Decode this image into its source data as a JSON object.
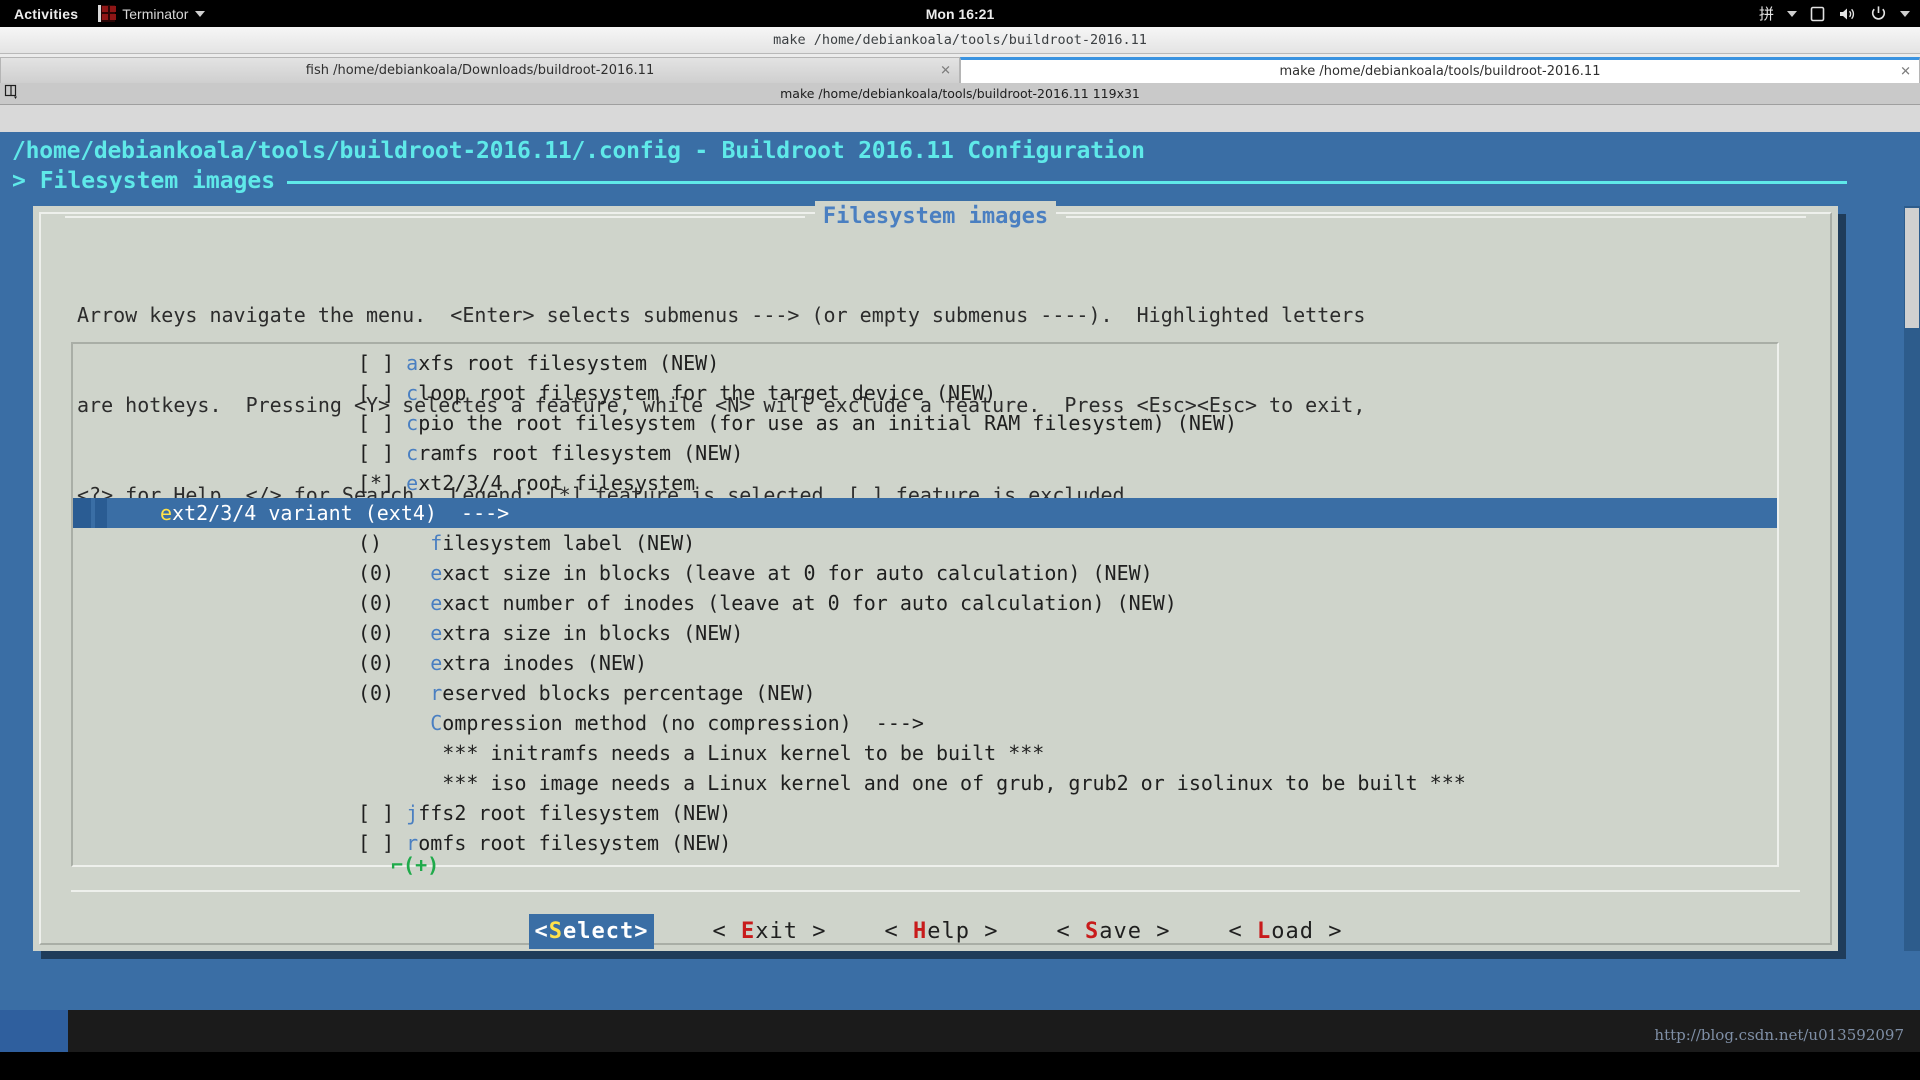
{
  "topbar": {
    "activities": "Activities",
    "app_name": "Terminator",
    "clock": "Mon 16:21",
    "ime": "拼"
  },
  "window": {
    "title": "make  /home/debiankoala/tools/buildroot-2016.11",
    "tabs": [
      {
        "label": "fish  /home/debiankoala/Downloads/buildroot-2016.11",
        "close": "✕",
        "active": false
      },
      {
        "label": "make  /home/debiankoala/tools/buildroot-2016.11",
        "close": "✕",
        "active": true
      }
    ],
    "terminal_title": "make  /home/debiankoala/tools/buildroot-2016.11 119x31"
  },
  "menuconfig": {
    "header_title": "/home/debiankoala/tools/buildroot-2016.11/.config - Buildroot 2016.11 Configuration",
    "breadcrumb": "> Filesystem images",
    "dialog_title": "Filesystem images",
    "help_lines": [
      "Arrow keys navigate the menu.  <Enter> selects submenus ---> (or empty submenus ----).  Highlighted letters",
      "are hotkeys.  Pressing <Y> selectes a feature, while <N> will exclude a feature.  Press <Esc><Esc> to exit,",
      "<?> for Help, </> for Search.  Legend: [*] feature is selected  [ ] feature is excluded"
    ],
    "scroll_hint": "⌐(+)",
    "items": [
      {
        "prefix": "[ ] ",
        "indent": "",
        "hotkey": "a",
        "text": "xfs root filesystem (NEW)",
        "suffix": "",
        "selected": false,
        "type": "checkbox"
      },
      {
        "prefix": "[ ] ",
        "indent": "",
        "hotkey": "c",
        "text": "loop root filesystem for the target device (NEW)",
        "suffix": "",
        "selected": false,
        "type": "checkbox"
      },
      {
        "prefix": "[ ] ",
        "indent": "",
        "hotkey": "c",
        "text": "pio the root filesystem (for use as an initial RAM filesystem) (NEW)",
        "suffix": "",
        "selected": false,
        "type": "checkbox"
      },
      {
        "prefix": "[ ] ",
        "indent": "",
        "hotkey": "c",
        "text": "ramfs root filesystem (NEW)",
        "suffix": "",
        "selected": false,
        "type": "checkbox"
      },
      {
        "prefix": "[*] ",
        "indent": "",
        "hotkey": "e",
        "text": "xt2/3/4 root filesystem",
        "suffix": "",
        "selected": false,
        "type": "checkbox"
      },
      {
        "prefix": "",
        "indent": "    ",
        "hotkey": "e",
        "text": "xt2/3/4 variant (ext4)",
        "suffix": "  --->",
        "selected": true,
        "type": "submenu"
      },
      {
        "prefix": "()  ",
        "indent": "  ",
        "hotkey": "f",
        "text": "ilesystem label (NEW)",
        "suffix": "",
        "selected": false,
        "type": "string"
      },
      {
        "prefix": "(0) ",
        "indent": "  ",
        "hotkey": "e",
        "text": "xact size in blocks (leave at 0 for auto calculation) (NEW)",
        "suffix": "",
        "selected": false,
        "type": "int"
      },
      {
        "prefix": "(0) ",
        "indent": "  ",
        "hotkey": "e",
        "text": "xact number of inodes (leave at 0 for auto calculation) (NEW)",
        "suffix": "",
        "selected": false,
        "type": "int"
      },
      {
        "prefix": "(0) ",
        "indent": "  ",
        "hotkey": "e",
        "text": "xtra size in blocks (NEW)",
        "suffix": "",
        "selected": false,
        "type": "int"
      },
      {
        "prefix": "(0) ",
        "indent": "  ",
        "hotkey": "e",
        "text": "xtra inodes (NEW)",
        "suffix": "",
        "selected": false,
        "type": "int"
      },
      {
        "prefix": "(0) ",
        "indent": "  ",
        "hotkey": "r",
        "text": "eserved blocks percentage (NEW)",
        "suffix": "",
        "selected": false,
        "type": "int"
      },
      {
        "prefix": "    ",
        "indent": "  ",
        "hotkey": "C",
        "text": "ompression method (no compression)",
        "suffix": "  --->",
        "selected": false,
        "type": "submenu"
      },
      {
        "prefix": "     ",
        "indent": "  ",
        "hotkey": "",
        "text": "*** initramfs needs a Linux kernel to be built ***",
        "suffix": "",
        "selected": false,
        "type": "comment"
      },
      {
        "prefix": "     ",
        "indent": "  ",
        "hotkey": "",
        "text": "*** iso image needs a Linux kernel and one of grub, grub2 or isolinux to be built ***",
        "suffix": "",
        "selected": false,
        "type": "comment"
      },
      {
        "prefix": "[ ] ",
        "indent": "",
        "hotkey": "j",
        "text": "ffs2 root filesystem (NEW)",
        "suffix": "",
        "selected": false,
        "type": "checkbox"
      },
      {
        "prefix": "[ ] ",
        "indent": "",
        "hotkey": "r",
        "text": "omfs root filesystem (NEW)",
        "suffix": "",
        "selected": false,
        "type": "checkbox"
      }
    ],
    "buttons": [
      {
        "open": "<",
        "hotkey": "S",
        "rest": "elect",
        "close": ">",
        "active": true
      },
      {
        "open": "< ",
        "hotkey": "E",
        "rest": "xit",
        "close": " >",
        "active": false
      },
      {
        "open": "< ",
        "hotkey": "H",
        "rest": "elp",
        "close": " >",
        "active": false
      },
      {
        "open": "< ",
        "hotkey": "S",
        "rest": "ave",
        "close": " >",
        "active": false
      },
      {
        "open": "< ",
        "hotkey": "L",
        "rest": "oad",
        "close": " >",
        "active": false
      }
    ]
  },
  "watermark": "http://blog.csdn.net/u013592097",
  "colors": {
    "terminal_bg": "#3a6ea5",
    "header_text": "#5fe9e9",
    "dialog_bg": "#cfd4cb",
    "hotkey_blue": "#4a7fc1",
    "hotkey_red": "#c81b1b",
    "hotkey_yellow": "#ffe24a",
    "selection_bg": "#3a6ea5",
    "scroll_green": "#1faa4a"
  }
}
